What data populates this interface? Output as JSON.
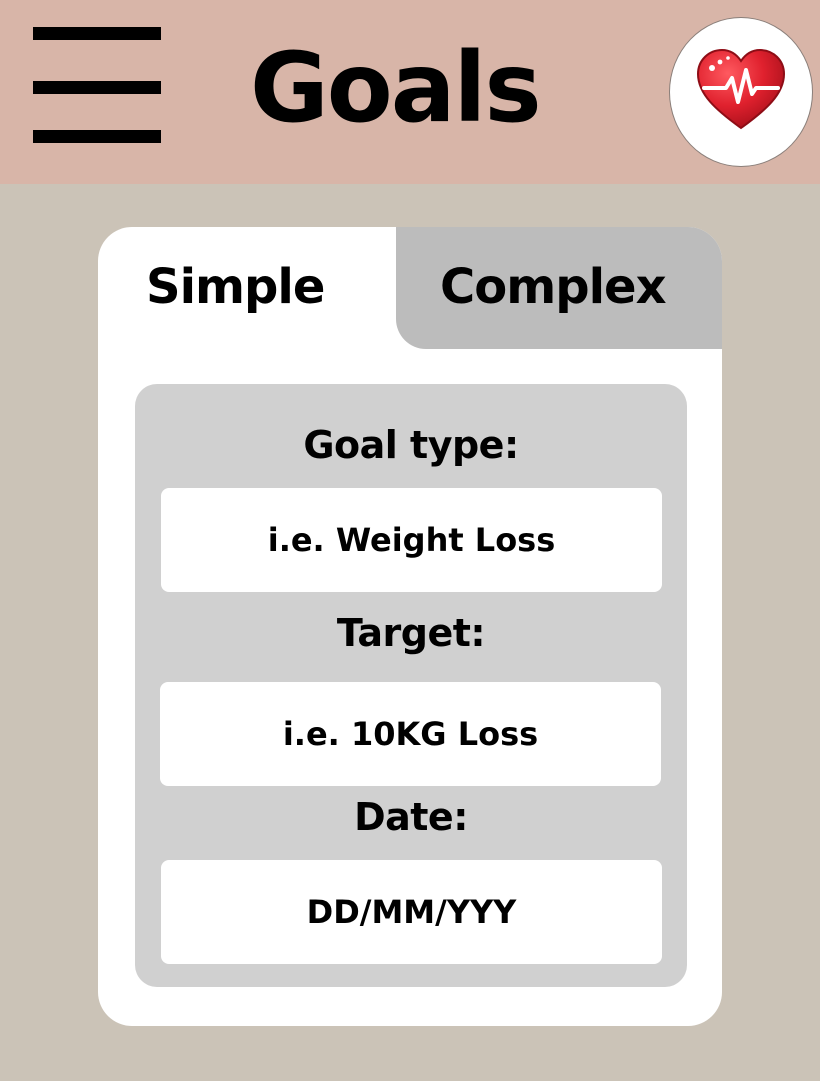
{
  "header": {
    "title": "Goals",
    "background_color": "#d8b5a8",
    "menu_icon": "hamburger-menu-icon",
    "logo_icon": "heart-pulse-icon",
    "logo_color": "#e0212e"
  },
  "tabs": [
    {
      "label": "Simple",
      "selected": true
    },
    {
      "label": "Complex",
      "selected": false
    }
  ],
  "form": {
    "goal_type": {
      "label": "Goal type:",
      "placeholder": "i.e. Weight Loss",
      "value": ""
    },
    "target": {
      "label": "Target:",
      "placeholder": "i.e. 10KG Loss",
      "value": ""
    },
    "date": {
      "label": "Date:",
      "placeholder": "DD/MM/YYY",
      "value": ""
    }
  },
  "colors": {
    "page_background": "#cbc3b7",
    "card_background": "#ffffff",
    "inactive_tab": "#bcbcbc",
    "form_panel": "#d0d0d0"
  }
}
